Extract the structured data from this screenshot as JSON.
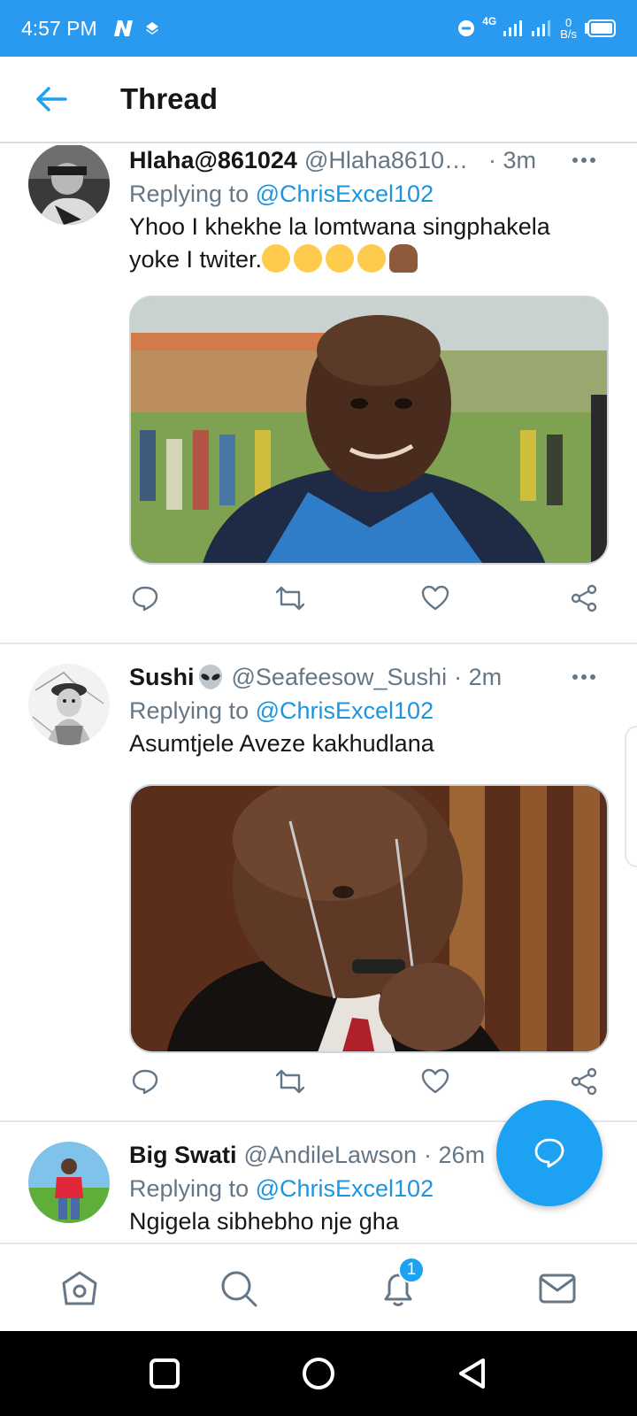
{
  "status_bar": {
    "time": "4:57 PM",
    "network_type": "4G",
    "net_speed_value": "0",
    "net_speed_unit": "B/s"
  },
  "header": {
    "title": "Thread"
  },
  "tweets": [
    {
      "name": "Hlaha@861024",
      "handle": "@Hlaha86102…",
      "time": "· 3m",
      "replying_prefix": "Replying to ",
      "replying_to": "@ChrisExcel102",
      "text": "Yhoo I khekhe la lomtwana singphakela yoke I twiter.",
      "emojis": [
        "face-with-tears-of-joy",
        "face-with-tears-of-joy",
        "face-with-tears-of-joy",
        "face-with-tears-of-joy",
        "person-facepalming"
      ],
      "media": "photo-smiling-man-stadium"
    },
    {
      "name": "Sushi",
      "name_emoji": "alien-emoji",
      "handle": "@Seafeesow_Sushi",
      "time": "· 2m",
      "replying_prefix": "Replying to ",
      "replying_to": "@ChrisExcel102",
      "text": "Asumtjele Aveze kakhudlana",
      "media": "photo-man-with-glasses"
    },
    {
      "name": "Big Swati",
      "handle": "@AndileLawson",
      "time": "· 26m",
      "replying_prefix": "Replying to ",
      "replying_to": "@ChrisExcel102",
      "text": "Ngigela sibhebho nje gha"
    }
  ],
  "bottom_nav": {
    "notification_count": "1"
  },
  "colors": {
    "status_bar": "#2a9af0",
    "accent": "#1da1f2",
    "mention": "#1b95e0",
    "secondary_text": "#657786"
  }
}
